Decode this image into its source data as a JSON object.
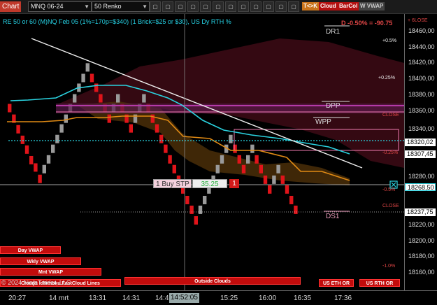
{
  "toolbar": {
    "chart_tab": "Chart",
    "instrument": "MNQ 06-24",
    "bar_type": "50 Renko",
    "tk_badge": "T<>K",
    "cloud_badge": "Cloud",
    "barcol_badge": "BarCol",
    "vwap_badge": "W VWAP"
  },
  "chart": {
    "title": "RE 50 or 60 (M)NQ Feb 05 (1%=170p=$340) (1 Brick=$25 or $30), US Dy RTH %",
    "pl_readout": "D -0.50% = -90.75",
    "levels": {
      "dr1": "DR1",
      "dpp": "DPP",
      "wpp": "WPP",
      "ds1": "DS1"
    },
    "pct_labels": {
      "p05": "+0.5%",
      "p025": "+0.25%",
      "close_top": "CLOSE",
      "m025": "-0.25%",
      "m05": "-0.5%",
      "close_bot": "CLOSE",
      "m1": "-1.0%"
    },
    "order": {
      "label": "1 Buy STP",
      "price": "35.25",
      "qty": "1"
    },
    "buttons": {
      "day_vwap": "Day VWAP",
      "wkly_vwap": "Wkly VWAP",
      "mnt_vwap": "Mnt VWAP",
      "fast_cloud": "Clouds Ichimoku FastCloud Lines",
      "outside_clouds": "Outside Clouds",
      "us_eth": "US ETH OR",
      "us_rth": "US RTH OR"
    },
    "copyright": "© 2024 NinjaTrader, LLC"
  },
  "yaxis": {
    "ticks": [
      "18460,00",
      "18440,00",
      "18420,00",
      "18400,00",
      "18380,00",
      "18360,00",
      "18340,00",
      "18280,00",
      "18220,00",
      "18200,00",
      "18180,00",
      "18160,00"
    ],
    "flags": {
      "upper": "18320,02",
      "mid": "18307,45",
      "current": "18268,50",
      "last": "18237,75"
    },
    "top_label": "+ 6LOSE"
  },
  "xaxis": {
    "ticks": [
      "20:27",
      "14 mrt",
      "13:31",
      "14:31",
      "14:4",
      "15:25",
      "16:00",
      "16:35",
      "17:36"
    ],
    "crosshair_time": "14:52:05"
  },
  "colors": {
    "bull": "#9a9a9a",
    "bear": "#e0141a",
    "cyan": "#2ad3e0",
    "orange": "#e08a14",
    "magenta": "#b53aa8",
    "cloud_red": "#3a0a14",
    "cloud_brown": "#4a2e08"
  },
  "chart_data": {
    "type": "renko",
    "brick_size": 6.25,
    "bricks": [
      [
        1,
        "d",
        18365
      ],
      [
        1,
        "d",
        18352
      ],
      [
        1,
        "d",
        18339
      ],
      [
        1,
        "d",
        18326
      ],
      [
        1,
        "d",
        18314
      ],
      [
        1,
        "d",
        18301
      ],
      [
        2,
        "d",
        18292
      ],
      [
        2,
        "d",
        18278
      ],
      [
        3,
        "u",
        18290
      ],
      [
        3,
        "u",
        18302
      ],
      [
        3,
        "u",
        18315
      ],
      [
        3,
        "u",
        18327
      ],
      [
        3,
        "u",
        18340
      ],
      [
        3,
        "u",
        18352
      ],
      [
        3,
        "u",
        18365
      ],
      [
        4,
        "u",
        18377
      ],
      [
        4,
        "u",
        18390
      ],
      [
        4,
        "u",
        18402
      ],
      [
        4,
        "u",
        18415
      ],
      [
        5,
        "d",
        18402
      ],
      [
        5,
        "d",
        18390
      ],
      [
        5,
        "d",
        18377
      ],
      [
        5,
        "d",
        18365
      ],
      [
        5,
        "d",
        18352
      ],
      [
        6,
        "u",
        18365
      ],
      [
        6,
        "u",
        18377
      ],
      [
        7,
        "d",
        18365
      ],
      [
        7,
        "d",
        18352
      ],
      [
        7,
        "d",
        18340
      ],
      [
        8,
        "u",
        18352
      ],
      [
        8,
        "u",
        18365
      ],
      [
        8,
        "u",
        18377
      ],
      [
        9,
        "d",
        18365
      ],
      [
        9,
        "d",
        18352
      ],
      [
        9,
        "d",
        18340
      ],
      [
        9,
        "d",
        18327
      ],
      [
        9,
        "d",
        18315
      ],
      [
        9,
        "d",
        18302
      ],
      [
        9,
        "d",
        18290
      ],
      [
        9,
        "d",
        18277
      ],
      [
        9,
        "d",
        18265
      ],
      [
        9,
        "d",
        18252
      ],
      [
        9,
        "d",
        18240
      ],
      [
        9,
        "d",
        18227
      ],
      [
        10,
        "u",
        18240
      ],
      [
        10,
        "u",
        18252
      ],
      [
        10,
        "u",
        18265
      ],
      [
        10,
        "u",
        18277
      ],
      [
        10,
        "u",
        18290
      ],
      [
        10,
        "u",
        18302
      ],
      [
        10,
        "u",
        18315
      ],
      [
        10,
        "u",
        18327
      ],
      [
        11,
        "d",
        18315
      ],
      [
        11,
        "d",
        18302
      ],
      [
        11,
        "d",
        18290
      ],
      [
        12,
        "u",
        18302
      ],
      [
        12,
        "u",
        18315
      ],
      [
        13,
        "d",
        18302
      ],
      [
        13,
        "d",
        18290
      ],
      [
        13,
        "d",
        18277
      ],
      [
        13,
        "d",
        18265
      ],
      [
        14,
        "u",
        18277
      ],
      [
        14,
        "u",
        18290
      ],
      [
        15,
        "d",
        18277
      ],
      [
        15,
        "d",
        18265
      ],
      [
        15,
        "d",
        18252
      ],
      [
        15,
        "d",
        18240
      ]
    ]
  }
}
